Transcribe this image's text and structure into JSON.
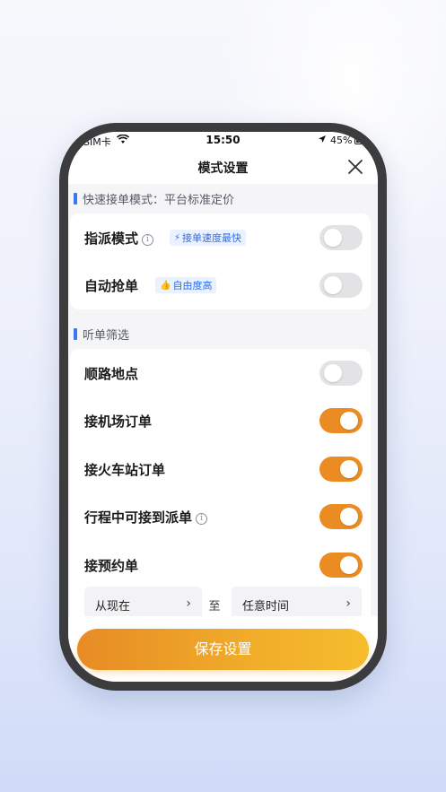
{
  "status_bar": {
    "carrier": "无SIM卡",
    "time": "15:50",
    "battery": "45%"
  },
  "header": {
    "title": "模式设置"
  },
  "section_fast": {
    "title": "快速接单模式：平台标准定价",
    "rows": [
      {
        "label": "指派模式",
        "tag": "接单速度最快",
        "tag_icon": "lightning-icon",
        "has_info": true,
        "enabled": false
      },
      {
        "label": "自动抢单",
        "tag": "自由度高",
        "tag_icon": "thumbs-up-icon",
        "has_info": false,
        "enabled": false
      }
    ]
  },
  "section_filter": {
    "title": "听单筛选",
    "rows": [
      {
        "label": "顺路地点",
        "has_info": false,
        "enabled": false
      },
      {
        "label": "接机场订单",
        "has_info": false,
        "enabled": true
      },
      {
        "label": "接火车站订单",
        "has_info": false,
        "enabled": true
      },
      {
        "label": "行程中可接到派单",
        "has_info": true,
        "enabled": true
      },
      {
        "label": "接预约单",
        "has_info": false,
        "enabled": true
      }
    ],
    "time_range": {
      "from": "从现在",
      "to_label": "至",
      "to": "任意时间"
    }
  },
  "footer": {
    "save_label": "保存设置"
  },
  "colors": {
    "accent": "#ea8c22",
    "tag_blue": "#2d6ee8",
    "section_bar": "#3a78f2"
  }
}
